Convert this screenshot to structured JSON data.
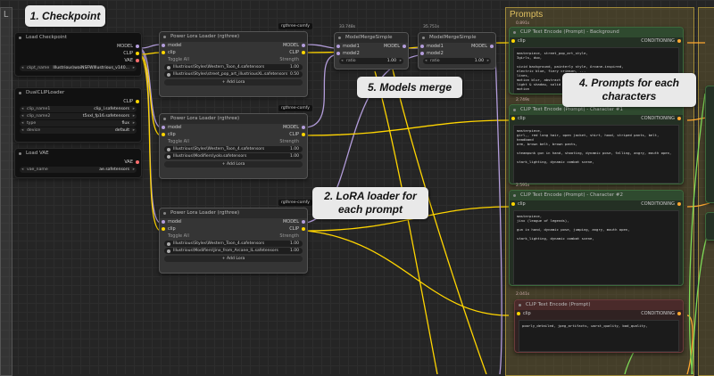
{
  "groups": {
    "prompts": "Prompts",
    "left_partial": "L"
  },
  "checkpoint": {
    "title": "Load Checkpoint",
    "out_model": "MODEL",
    "out_clip": "CLIP",
    "out_vae": "VAE",
    "w_key": "ckpt_name",
    "w_val": "Illustrious\\waiNSFWIllustrious_v140..."
  },
  "dualclip": {
    "title": "DualCLIPLoader",
    "out_clip": "CLIP",
    "w": [
      {
        "k": "clip_name1",
        "v": "clip_l.safetensors"
      },
      {
        "k": "clip_name2",
        "v": "t5xxl_fp16.safetensors"
      },
      {
        "k": "type",
        "v": "flux"
      },
      {
        "k": "device",
        "v": "default"
      }
    ]
  },
  "vae": {
    "title": "Load VAE",
    "out_vae": "VAE",
    "w_key": "vae_name",
    "w_val": "ae.safetensors"
  },
  "lora1": {
    "tag": "rgthree-comfy",
    "title": "Power Lora Loader (rgthree)",
    "in_model": "model",
    "in_clip": "clip",
    "out_model": "MODEL",
    "out_clip": "CLIP",
    "toggle": "Toggle All",
    "strength": "Strength",
    "loras": [
      {
        "n": "Illustrious\\Styles\\Western_Toon_4.safetensors",
        "s": "1.00"
      },
      {
        "n": "Illustrious\\Styles\\street_pop_art_illustriousXL.safetensors",
        "s": "0.50"
      }
    ],
    "add": "+ Add Lora"
  },
  "lora2": {
    "tag": "rgthree-comfy",
    "title": "Power Lora Loader (rgthree)",
    "in_model": "model",
    "in_clip": "clip",
    "out_model": "MODEL",
    "out_clip": "CLIP",
    "toggle": "Toggle All",
    "strength": "Strength",
    "loras": [
      {
        "n": "Illustrious\\Styles\\Western_Toon_4.safetensors",
        "s": "1.00"
      },
      {
        "n": "Illustrious\\Modifiers\\yolo.safetensors",
        "s": "1.00"
      }
    ],
    "add": "+ Add Lora"
  },
  "lora3": {
    "tag": "rgthree-comfy",
    "title": "Power Lora Loader (rgthree)",
    "in_model": "model",
    "in_clip": "clip",
    "out_model": "MODEL",
    "out_clip": "CLIP",
    "toggle": "Toggle All",
    "strength": "Strength",
    "loras": [
      {
        "n": "Illustrious\\Styles\\Western_Toon_4.safetensors",
        "s": "1.00"
      },
      {
        "n": "Illustrious\\Modifiers\\Jinx_from_Arcane_IL.safetensors",
        "s": "1.00"
      }
    ],
    "add": "+ Add Lora"
  },
  "merge1": {
    "size": "33.748s",
    "title": "ModelMergeSimple",
    "in1": "model1",
    "in2": "model2",
    "out": "MODEL",
    "w_key": "ratio",
    "w_val": "1.00"
  },
  "merge2": {
    "size": "35.751s",
    "title": "ModelMergeSimple",
    "in1": "model1",
    "in2": "model2",
    "out": "MODEL",
    "w_key": "ratio",
    "w_val": "1.00"
  },
  "clip_bg": {
    "size": "0.891s",
    "title": "CLIP Text Encode (Prompt) - Background",
    "in": "clip",
    "out": "CONDITIONING",
    "text": "masterpiece, street_pop_art_style,\n3girls, duo,\n\nvivid background, painterly style, Arcane-inspired,\nelectric blue, fiery crimson, ...\nlines,\nmotion blur, abstract background, ...\nlight & shadow, solid color, ...\nmotion"
  },
  "clip_c1": {
    "size": "2.749s",
    "title": "CLIP Text Encode (Prompt) - Character #1",
    "in": "clip",
    "out": "CONDITIONING",
    "text": "masterpiece,\ngirl,, red long hair, open jacket, shirt, hood, striped pants, belt, headband\narm, brown belt, brown pants,\n\nsteampunk gun in hand, shooting, dynamic pose, falling, angry, mouth open,\n\nstark_lighting, dynamic combat scene,"
  },
  "clip_c2": {
    "size": "2.591s",
    "title": "CLIP Text Encode (Prompt) - Character #2",
    "in": "clip",
    "out": "CONDITIONING",
    "text": "masterpiece,\njinx (league of legends),\n\ngun in hand, dynamic pose, jumping, angry, mouth open,\n\nstark_lighting, dynamic combat scene,"
  },
  "clip_neg": {
    "size": "2.041s",
    "title": "CLIP Text Encode (Prompt)",
    "in": "clip",
    "out": "CONDITIONING",
    "text": "poorly_detailed, jpeg_artifacts, worst_quality, bad_quality,"
  },
  "callouts": {
    "c1": "1. Checkpoint",
    "c2": "2. LoRA loader for each prompt",
    "c4": "4. Prompts for each characters",
    "c5": "5. Models merge"
  },
  "colors": {
    "model": "#b39ddb",
    "clip": "#ffd500",
    "conditioning": "#ffa931",
    "vae": "#ff6e6e",
    "green_wire": "#7ed957"
  }
}
